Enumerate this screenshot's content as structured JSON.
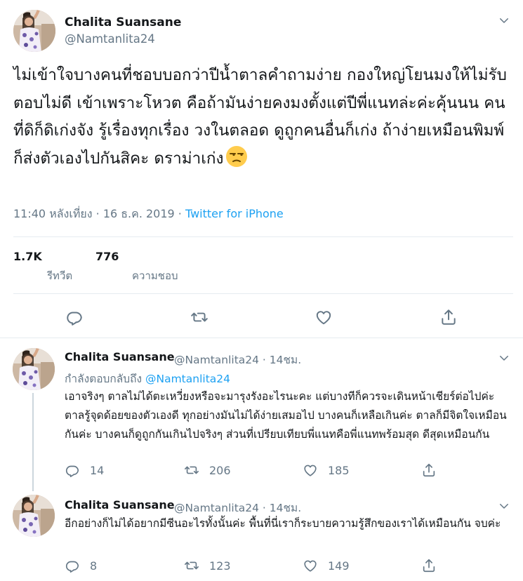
{
  "main": {
    "author_name": "Chalita Suansane",
    "author_handle": "@Namtanlita24",
    "text": "ไม่เข้าใจบางคนที่ชอบบอกว่าปีน้ำตาลคำถามง่าย กองใหญ่โยนมงให้ไม่รับ ตอบไม่ดี เข้าเพราะโหวต คือถ้ามันง่ายคงมงตั้งแต่ปีพี่แนทล่ะค่ะคุ้นนน คนที่ดิก็ดิเก่งจัง รู้เรื่องทุกเรื่อง วงในตลอด ดูถูกคนอื่นก็เก่ง ถ้าง่ายเหมือนพิมพ์ก็ส่งตัวเองไปกันสิคะ ดราม่าเก่ง",
    "emoji": "unamused-face-emoji",
    "time": "11:40 หลังเที่ยง · 16 ธ.ค. 2019 · ",
    "source": "Twitter for iPhone",
    "retweets": "1.7K",
    "retweets_label": "รีทวีต",
    "likes": "776",
    "likes_label": "ความชอบ"
  },
  "replies": [
    {
      "author_name": "Chalita Suansane",
      "author_handle": "@Namtanlita24 · 14ชม.",
      "replying_prefix": "กำลังตอบกลับถึง ",
      "replying_to": "@Namtanlita24",
      "text": "เอาจริงๆ ตาลไม่ได้ตะเหวี่ยงหรือจะมารุงรังอะไรนะคะ แต่บางทีก็ควรจะเดินหน้าเชียร์ต่อไปค่ะ ตาลรู้จุดด้อยของตัวเองดี ทุกอย่างมันไม่ได้ง่ายเสมอไป บางคนก็เหลือเกินค่ะ ตาลก็มีจิตใจเหมือนกันค่ะ บางคนก็ดูถูกกันเกินไปจริงๆ ส่วนที่เปรียบเทียบพี่แนทคือพี่แนทพร้อมสุด ดีสุดเหมือนกัน",
      "replies": "14",
      "retweets": "206",
      "likes": "185"
    },
    {
      "author_name": "Chalita Suansane",
      "author_handle": "@Namtanlita24 · 14ชม.",
      "text": "อีกอย่างก็ไม่ได้อยากมีซีนอะไรทั้งนั้นค่ะ พื้นที่นี่เราก็ระบายความรู้สึกของเราได้เหมือนกัน จบค่ะ",
      "replies": "8",
      "retweets": "123",
      "likes": "149"
    }
  ],
  "icons": {
    "reply": "reply-icon",
    "retweet": "retweet-icon",
    "like": "heart-icon",
    "share": "share-icon",
    "menu": "chevron-down-icon"
  },
  "colors": {
    "text": "#14171a",
    "secondary": "#657786",
    "link": "#1da1f2",
    "border": "#e6ecf0"
  }
}
